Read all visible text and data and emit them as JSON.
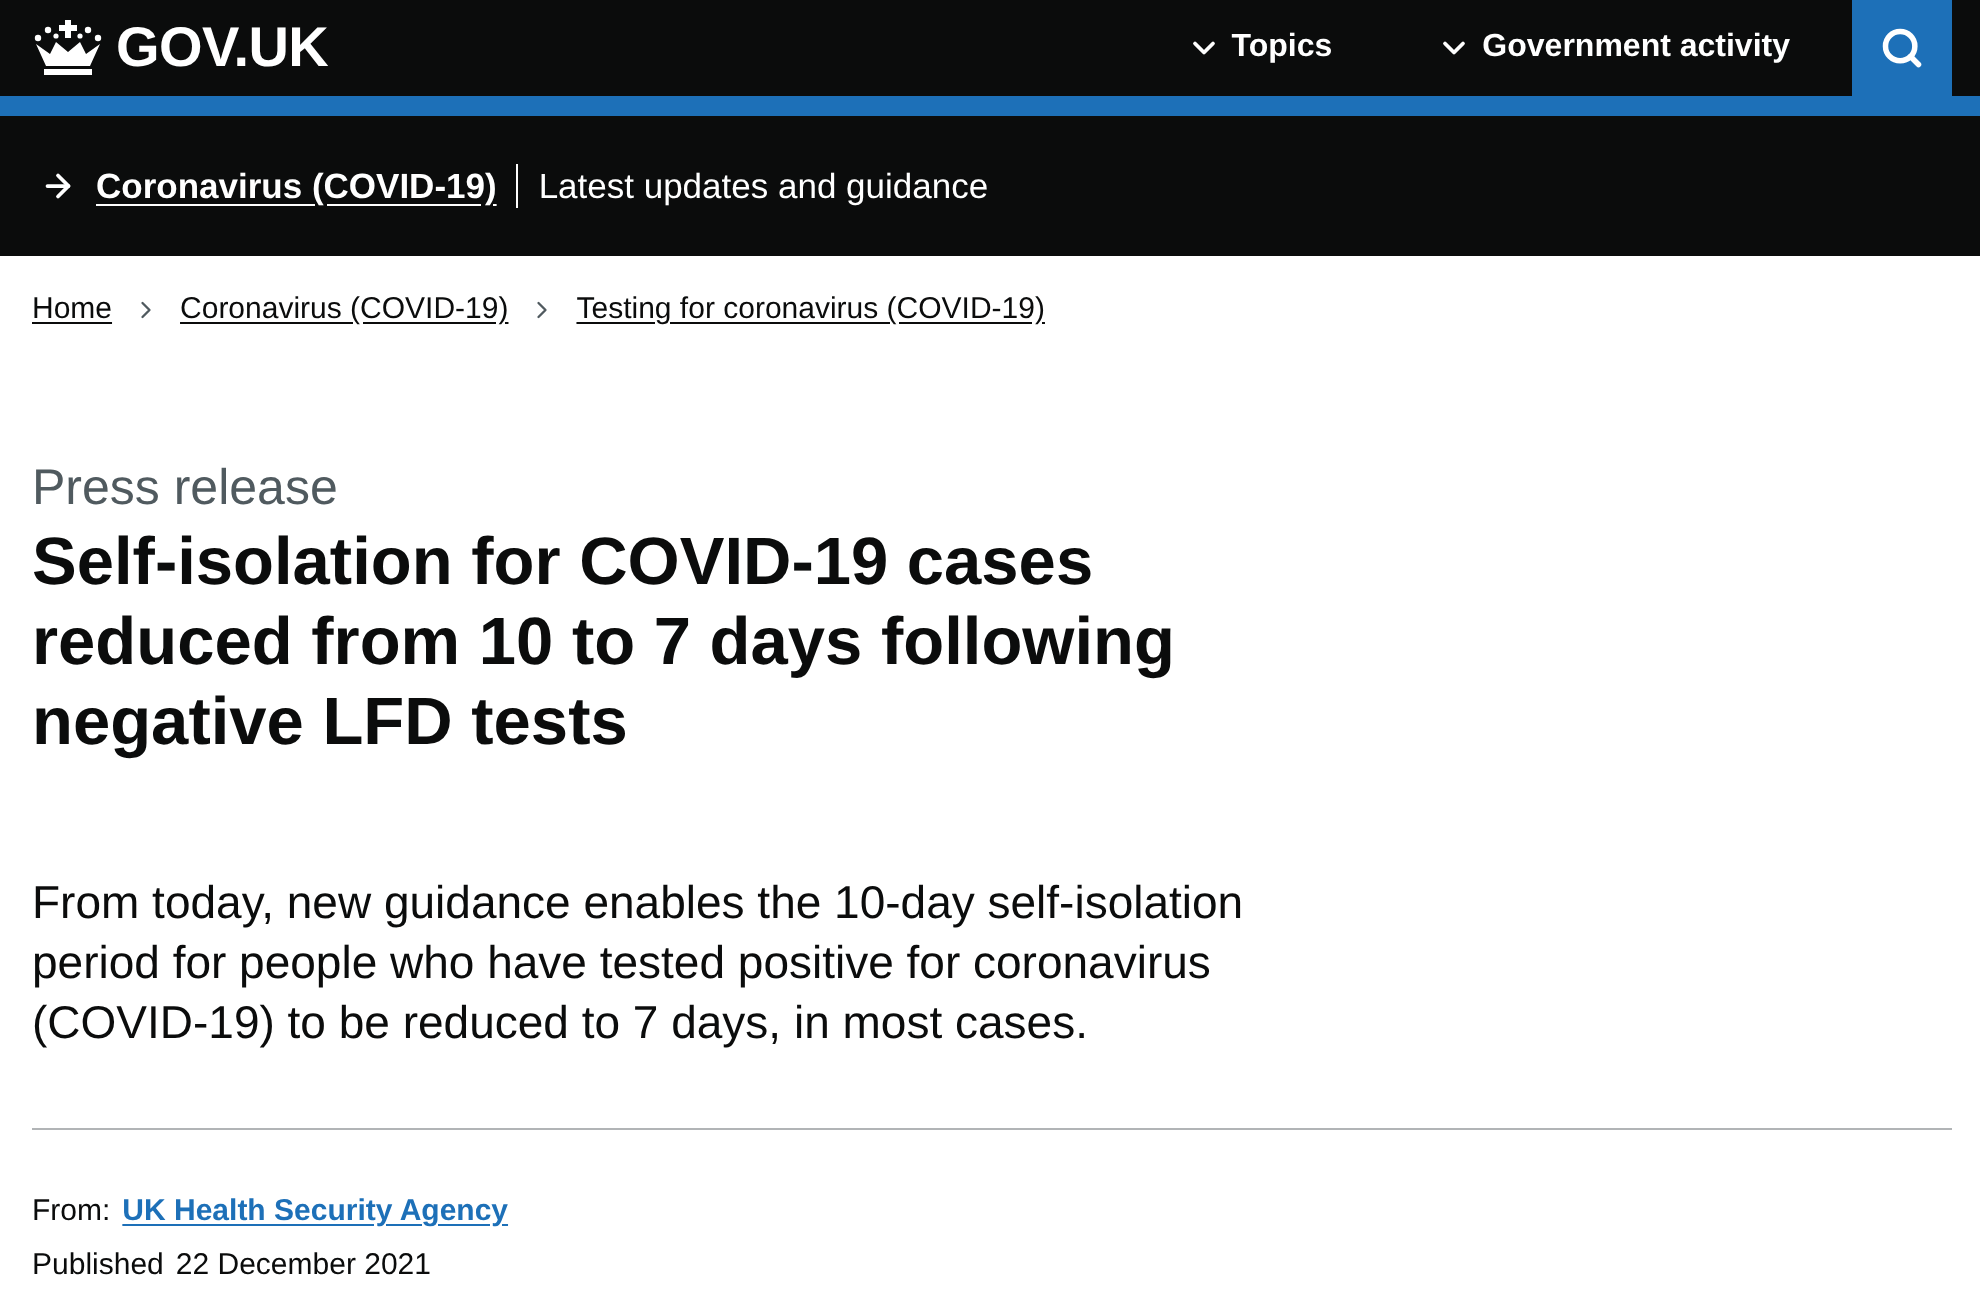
{
  "header": {
    "logo": "GOV.UK",
    "nav": [
      {
        "label": "Topics",
        "expanded": false
      },
      {
        "label": "Government activity",
        "expanded": false
      }
    ]
  },
  "banner": {
    "link": "Coronavirus (COVID-19)",
    "text": "Latest updates and guidance"
  },
  "breadcrumbs": [
    "Home",
    "Coronavirus (COVID-19)",
    "Testing for coronavirus (COVID-19)"
  ],
  "article": {
    "type": "Press release",
    "title": "Self-isolation for COVID-19 cases reduced from 10 to 7 days following negative LFD tests",
    "lead": "From today, new guidance enables the 10-day self-isolation period for people who have tested positive for coronavirus (COVID-19) to be reduced to 7 days, in most cases.",
    "metadata": {
      "from_label": "From:",
      "from_link": "UK Health Security Agency",
      "published_label": "Published",
      "published_date": "22 December 2021"
    }
  }
}
